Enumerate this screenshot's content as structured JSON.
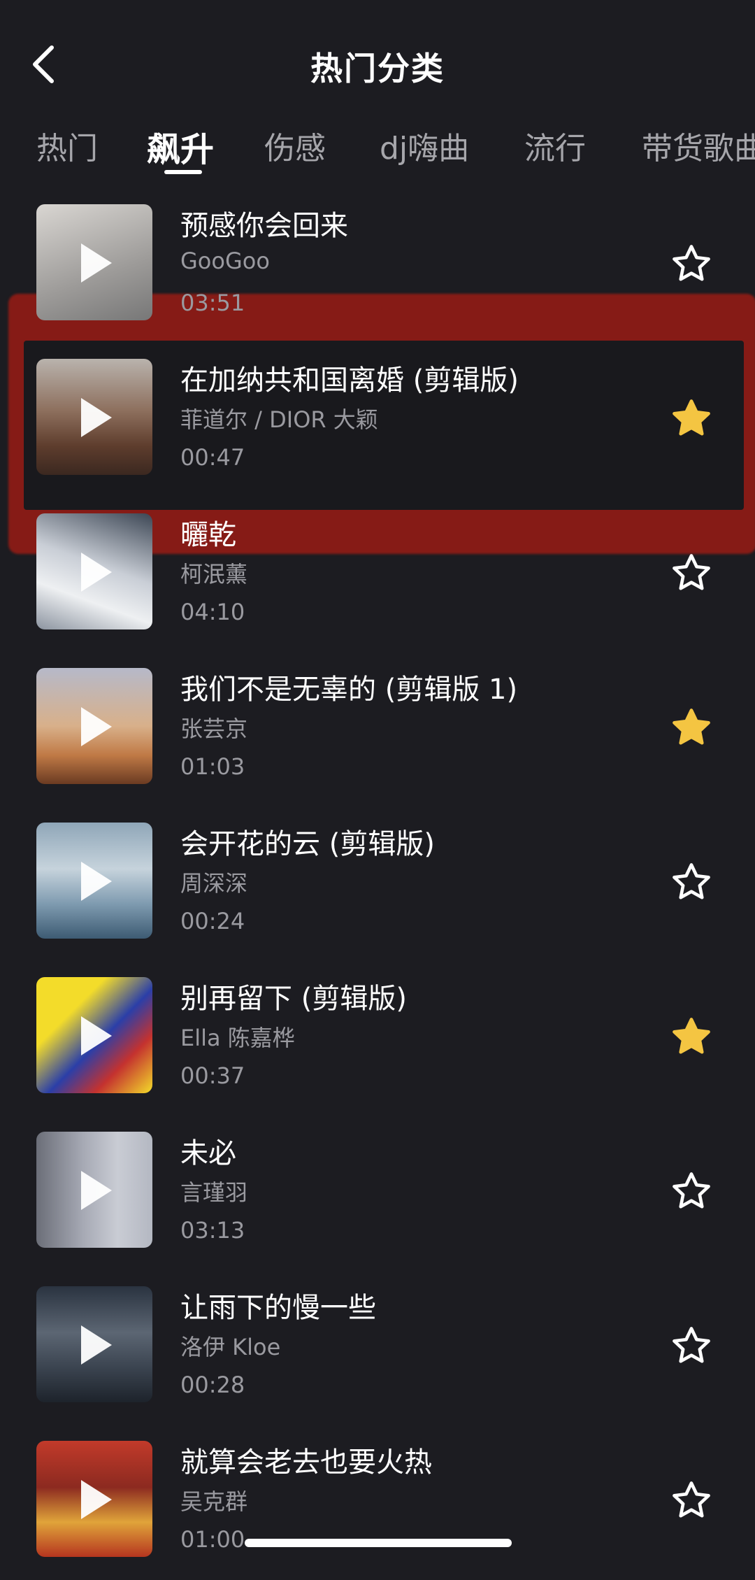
{
  "header": {
    "title": "热门分类",
    "back_icon": "chevron-left-icon"
  },
  "tabs": [
    {
      "label": "热门",
      "active": false
    },
    {
      "label": "飙升",
      "active": true
    },
    {
      "label": "伤感",
      "active": false
    },
    {
      "label": "dj嗨曲",
      "active": false
    },
    {
      "label": "流行",
      "active": false
    },
    {
      "label": "带货歌曲",
      "active": false
    }
  ],
  "songs": [
    {
      "title": "预感你会回来",
      "artist": "GooGoo",
      "duration": "03:51",
      "favorited": false
    },
    {
      "title": "在加纳共和国离婚 (剪辑版)",
      "artist": "菲道尔 / DIOR 大颖",
      "duration": "00:47",
      "favorited": true
    },
    {
      "title": "曬乾",
      "artist": "柯泯薰",
      "duration": "04:10",
      "favorited": false
    },
    {
      "title": "我们不是无辜的 (剪辑版 1)",
      "artist": "张芸京",
      "duration": "01:03",
      "favorited": true
    },
    {
      "title": "会开花的云 (剪辑版)",
      "artist": "周深深",
      "duration": "00:24",
      "favorited": false
    },
    {
      "title": "别再留下 (剪辑版)",
      "artist": "Ella 陈嘉桦",
      "duration": "00:37",
      "favorited": true
    },
    {
      "title": "未必",
      "artist": "言瑾羽",
      "duration": "03:13",
      "favorited": false
    },
    {
      "title": "让雨下的慢一些",
      "artist": "洛伊 Kloe",
      "duration": "00:28",
      "favorited": false
    },
    {
      "title": "就算会老去也要火热",
      "artist": "吴克群",
      "duration": "01:00",
      "favorited": false
    }
  ],
  "colors": {
    "background": "#1c1c21",
    "star_filled": "#f4c542",
    "highlight": "#b01c12"
  }
}
